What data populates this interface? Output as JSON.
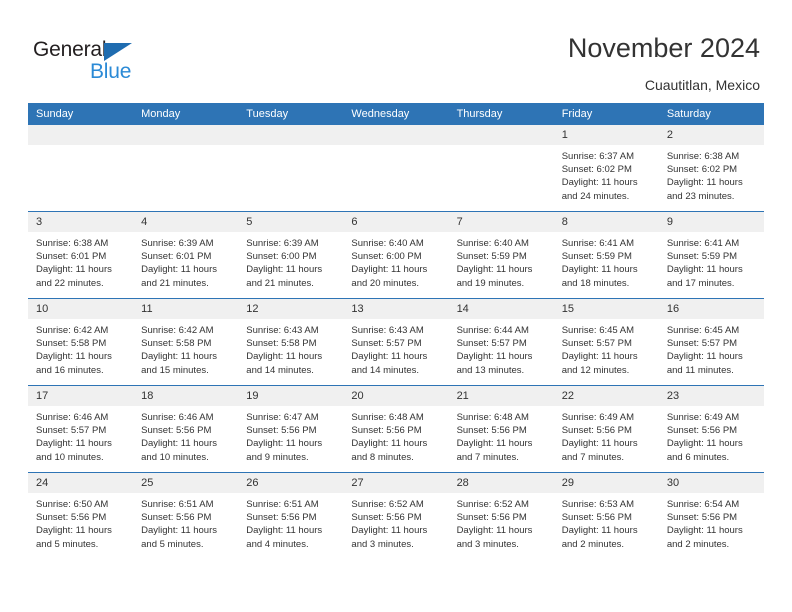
{
  "brand": {
    "name_part1": "General",
    "name_part2": "Blue",
    "triangle_color": "#1f6cb0",
    "blue_color": "#2b8ad6",
    "dark_color": "#231f20"
  },
  "header": {
    "title": "November 2024",
    "subtitle": "Cuautitlan, Mexico"
  },
  "theme": {
    "header_bg": "#2e74b5",
    "daynum_bg": "#f0f0f0",
    "text": "#333333",
    "row_divider": "#2e74b5"
  },
  "weekday_headers": [
    "Sunday",
    "Monday",
    "Tuesday",
    "Wednesday",
    "Thursday",
    "Friday",
    "Saturday"
  ],
  "weeks": [
    [
      {
        "day": "",
        "lines": []
      },
      {
        "day": "",
        "lines": []
      },
      {
        "day": "",
        "lines": []
      },
      {
        "day": "",
        "lines": []
      },
      {
        "day": "",
        "lines": []
      },
      {
        "day": "1",
        "lines": [
          "Sunrise: 6:37 AM",
          "Sunset: 6:02 PM",
          "Daylight: 11 hours",
          "and 24 minutes."
        ]
      },
      {
        "day": "2",
        "lines": [
          "Sunrise: 6:38 AM",
          "Sunset: 6:02 PM",
          "Daylight: 11 hours",
          "and 23 minutes."
        ]
      }
    ],
    [
      {
        "day": "3",
        "lines": [
          "Sunrise: 6:38 AM",
          "Sunset: 6:01 PM",
          "Daylight: 11 hours",
          "and 22 minutes."
        ]
      },
      {
        "day": "4",
        "lines": [
          "Sunrise: 6:39 AM",
          "Sunset: 6:01 PM",
          "Daylight: 11 hours",
          "and 21 minutes."
        ]
      },
      {
        "day": "5",
        "lines": [
          "Sunrise: 6:39 AM",
          "Sunset: 6:00 PM",
          "Daylight: 11 hours",
          "and 21 minutes."
        ]
      },
      {
        "day": "6",
        "lines": [
          "Sunrise: 6:40 AM",
          "Sunset: 6:00 PM",
          "Daylight: 11 hours",
          "and 20 minutes."
        ]
      },
      {
        "day": "7",
        "lines": [
          "Sunrise: 6:40 AM",
          "Sunset: 5:59 PM",
          "Daylight: 11 hours",
          "and 19 minutes."
        ]
      },
      {
        "day": "8",
        "lines": [
          "Sunrise: 6:41 AM",
          "Sunset: 5:59 PM",
          "Daylight: 11 hours",
          "and 18 minutes."
        ]
      },
      {
        "day": "9",
        "lines": [
          "Sunrise: 6:41 AM",
          "Sunset: 5:59 PM",
          "Daylight: 11 hours",
          "and 17 minutes."
        ]
      }
    ],
    [
      {
        "day": "10",
        "lines": [
          "Sunrise: 6:42 AM",
          "Sunset: 5:58 PM",
          "Daylight: 11 hours",
          "and 16 minutes."
        ]
      },
      {
        "day": "11",
        "lines": [
          "Sunrise: 6:42 AM",
          "Sunset: 5:58 PM",
          "Daylight: 11 hours",
          "and 15 minutes."
        ]
      },
      {
        "day": "12",
        "lines": [
          "Sunrise: 6:43 AM",
          "Sunset: 5:58 PM",
          "Daylight: 11 hours",
          "and 14 minutes."
        ]
      },
      {
        "day": "13",
        "lines": [
          "Sunrise: 6:43 AM",
          "Sunset: 5:57 PM",
          "Daylight: 11 hours",
          "and 14 minutes."
        ]
      },
      {
        "day": "14",
        "lines": [
          "Sunrise: 6:44 AM",
          "Sunset: 5:57 PM",
          "Daylight: 11 hours",
          "and 13 minutes."
        ]
      },
      {
        "day": "15",
        "lines": [
          "Sunrise: 6:45 AM",
          "Sunset: 5:57 PM",
          "Daylight: 11 hours",
          "and 12 minutes."
        ]
      },
      {
        "day": "16",
        "lines": [
          "Sunrise: 6:45 AM",
          "Sunset: 5:57 PM",
          "Daylight: 11 hours",
          "and 11 minutes."
        ]
      }
    ],
    [
      {
        "day": "17",
        "lines": [
          "Sunrise: 6:46 AM",
          "Sunset: 5:57 PM",
          "Daylight: 11 hours",
          "and 10 minutes."
        ]
      },
      {
        "day": "18",
        "lines": [
          "Sunrise: 6:46 AM",
          "Sunset: 5:56 PM",
          "Daylight: 11 hours",
          "and 10 minutes."
        ]
      },
      {
        "day": "19",
        "lines": [
          "Sunrise: 6:47 AM",
          "Sunset: 5:56 PM",
          "Daylight: 11 hours",
          "and 9 minutes."
        ]
      },
      {
        "day": "20",
        "lines": [
          "Sunrise: 6:48 AM",
          "Sunset: 5:56 PM",
          "Daylight: 11 hours",
          "and 8 minutes."
        ]
      },
      {
        "day": "21",
        "lines": [
          "Sunrise: 6:48 AM",
          "Sunset: 5:56 PM",
          "Daylight: 11 hours",
          "and 7 minutes."
        ]
      },
      {
        "day": "22",
        "lines": [
          "Sunrise: 6:49 AM",
          "Sunset: 5:56 PM",
          "Daylight: 11 hours",
          "and 7 minutes."
        ]
      },
      {
        "day": "23",
        "lines": [
          "Sunrise: 6:49 AM",
          "Sunset: 5:56 PM",
          "Daylight: 11 hours",
          "and 6 minutes."
        ]
      }
    ],
    [
      {
        "day": "24",
        "lines": [
          "Sunrise: 6:50 AM",
          "Sunset: 5:56 PM",
          "Daylight: 11 hours",
          "and 5 minutes."
        ]
      },
      {
        "day": "25",
        "lines": [
          "Sunrise: 6:51 AM",
          "Sunset: 5:56 PM",
          "Daylight: 11 hours",
          "and 5 minutes."
        ]
      },
      {
        "day": "26",
        "lines": [
          "Sunrise: 6:51 AM",
          "Sunset: 5:56 PM",
          "Daylight: 11 hours",
          "and 4 minutes."
        ]
      },
      {
        "day": "27",
        "lines": [
          "Sunrise: 6:52 AM",
          "Sunset: 5:56 PM",
          "Daylight: 11 hours",
          "and 3 minutes."
        ]
      },
      {
        "day": "28",
        "lines": [
          "Sunrise: 6:52 AM",
          "Sunset: 5:56 PM",
          "Daylight: 11 hours",
          "and 3 minutes."
        ]
      },
      {
        "day": "29",
        "lines": [
          "Sunrise: 6:53 AM",
          "Sunset: 5:56 PM",
          "Daylight: 11 hours",
          "and 2 minutes."
        ]
      },
      {
        "day": "30",
        "lines": [
          "Sunrise: 6:54 AM",
          "Sunset: 5:56 PM",
          "Daylight: 11 hours",
          "and 2 minutes."
        ]
      }
    ]
  ]
}
